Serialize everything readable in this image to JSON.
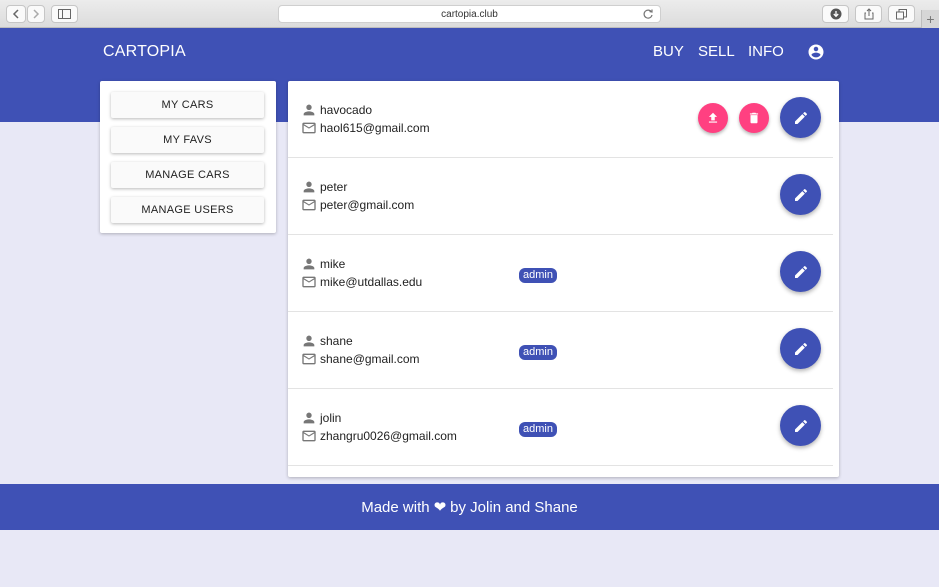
{
  "browser": {
    "url": "cartopia.club"
  },
  "header": {
    "brand": "CARTOPIA",
    "nav": [
      "BUY",
      "SELL",
      "INFO"
    ]
  },
  "sidebar": {
    "items": [
      {
        "label": "MY CARS"
      },
      {
        "label": "MY FAVS"
      },
      {
        "label": "MANAGE CARS"
      },
      {
        "label": "MANAGE USERS"
      }
    ]
  },
  "users": [
    {
      "username": "havocado",
      "email": "haol615@gmail.com",
      "badge": "",
      "actions": [
        "upload-icon",
        "delete-icon",
        "edit-icon"
      ]
    },
    {
      "username": "peter",
      "email": "peter@gmail.com",
      "badge": "",
      "actions": [
        "edit-icon"
      ]
    },
    {
      "username": "mike",
      "email": "mike@utdallas.edu",
      "badge": "admin",
      "actions": [
        "edit-icon"
      ]
    },
    {
      "username": "shane",
      "email": "shane@gmail.com",
      "badge": "admin",
      "actions": [
        "edit-icon"
      ]
    },
    {
      "username": "jolin",
      "email": "zhangru0026@gmail.com",
      "badge": "admin",
      "actions": [
        "edit-icon"
      ]
    }
  ],
  "footer": {
    "prefix": "Made with",
    "heart": "❤",
    "suffix": "by Jolin and Shane"
  },
  "colors": {
    "primary": "#3f51b5",
    "accent": "#ff4081",
    "page_background": "#e8e8f6"
  }
}
